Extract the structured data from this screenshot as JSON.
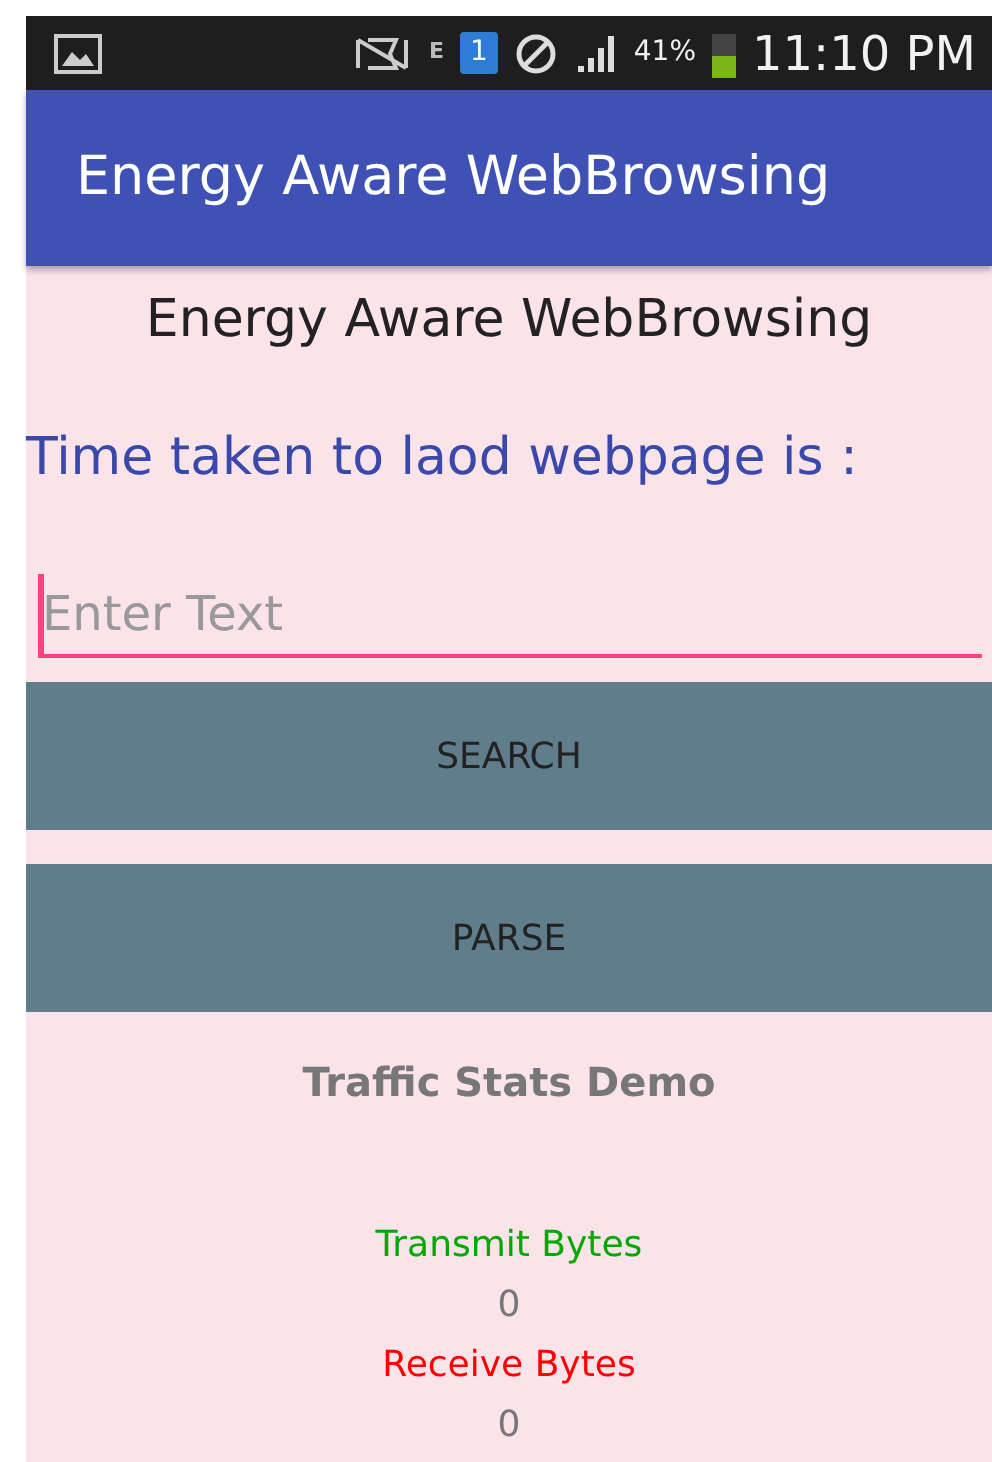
{
  "status_bar": {
    "network_type": "E",
    "sim_badge": "1",
    "battery_percent": "41%",
    "time": "11:10 PM"
  },
  "app_bar": {
    "title": "Energy Aware WebBrowsing"
  },
  "heading": "Energy Aware WebBrowsing",
  "load_time_label": "Time taken to laod webpage is :",
  "search_field": {
    "placeholder": "Enter Text",
    "focused": true
  },
  "buttons": [
    "SEARCH",
    "PARSE"
  ],
  "traffic_stats": {
    "title": "Traffic Stats Demo",
    "stats": [
      {
        "label": "Transmit Bytes",
        "color": "#00a800",
        "value": "0"
      },
      {
        "label": "Receive Bytes",
        "color": "#ff0000",
        "value": "0"
      }
    ]
  }
}
